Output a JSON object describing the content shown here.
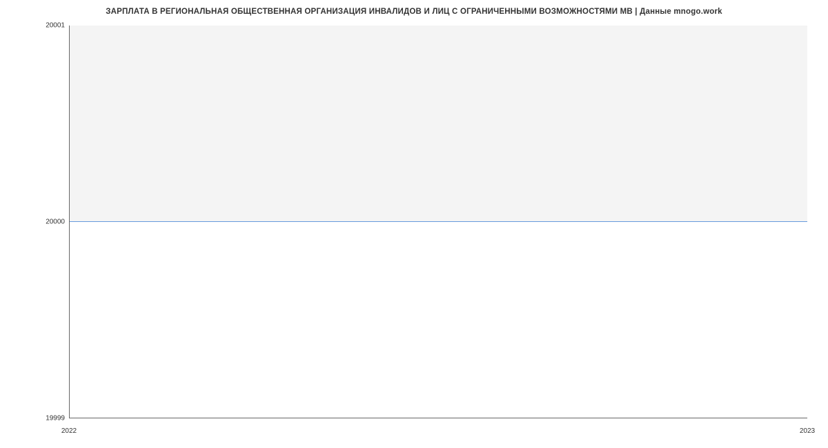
{
  "chart_data": {
    "type": "area",
    "title": "ЗАРПЛАТА В РЕГИОНАЛЬНАЯ ОБЩЕСТВЕННАЯ ОРГАНИЗАЦИЯ ИНВАЛИДОВ И ЛИЦ С ОГРАНИЧЕННЫМИ ВОЗМОЖНОСТЯМИ МВ | Данные mnogo.work",
    "x": [
      "2022",
      "2023"
    ],
    "values": [
      20000,
      20000
    ],
    "xlabel": "",
    "ylabel": "",
    "ylim": [
      19999,
      20001
    ],
    "y_ticks": [
      "19999",
      "20000",
      "20001"
    ],
    "x_ticks": [
      "2022",
      "2023"
    ],
    "line_color": "#6699dd",
    "fill_color": "#f4f4f4"
  }
}
